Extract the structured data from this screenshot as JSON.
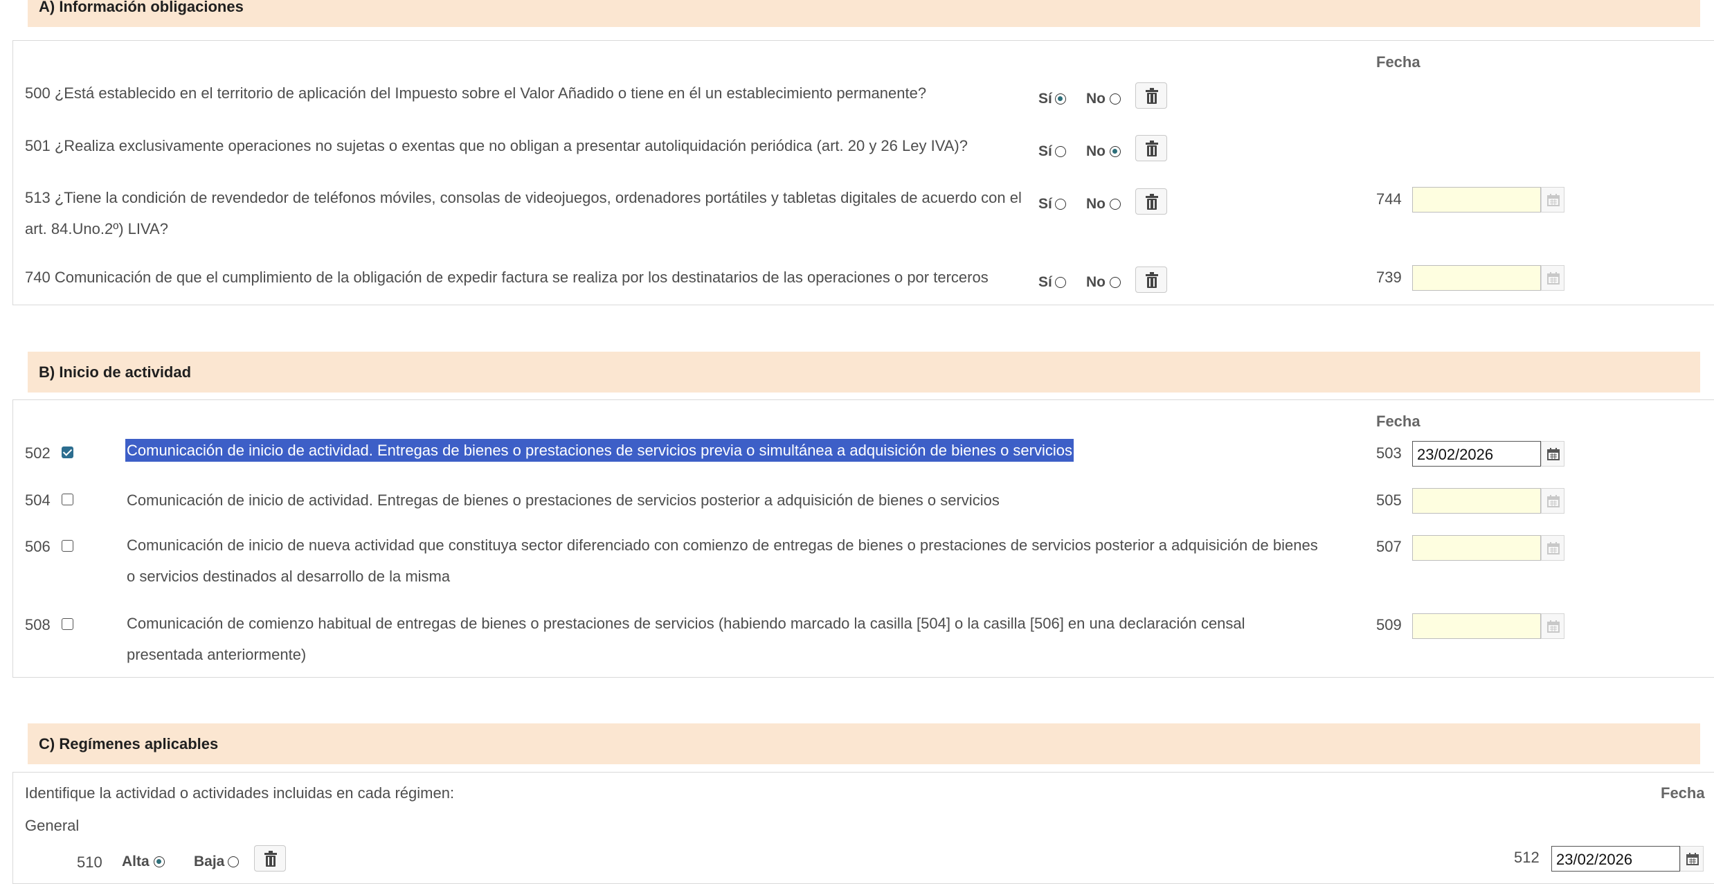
{
  "sectionA": {
    "title": "A) Información obligaciones",
    "fecha_label": "Fecha",
    "yes_label": "Sí",
    "no_label": "No",
    "rows": [
      {
        "code": "500",
        "text": "500 ¿Está establecido en el territorio de aplicación del Impuesto sobre el Valor Añadido o tiene en él un establecimiento permanente?",
        "selected": "si"
      },
      {
        "code": "501",
        "text": "501 ¿Realiza exclusivamente operaciones no sujetas o exentas que no obligan a presentar autoliquidación periódica (art. 20 y 26 Ley IVA)?",
        "selected": "no"
      },
      {
        "code": "513",
        "text": "513 ¿Tiene la condición de revendedor de teléfonos móviles, consolas de videojuegos, ordenadores portátiles y tabletas digitales de acuerdo con el art. 84.Uno.2º) LIVA?",
        "selected": "none",
        "date_code": "744",
        "date_value": ""
      },
      {
        "code": "740",
        "text": "740 Comunicación de que el cumplimiento de la obligación de expedir factura se realiza por los destinatarios de las operaciones o por terceros",
        "selected": "none",
        "date_code": "739",
        "date_value": ""
      }
    ]
  },
  "sectionB": {
    "title": "B) Inicio de actividad",
    "fecha_label": "Fecha",
    "rows": [
      {
        "code": "502",
        "checked": true,
        "text": "Comunicación de inicio de actividad. Entregas de bienes o prestaciones de servicios previa o simultánea a adquisición de bienes o servicios",
        "date_code": "503",
        "date_value": "23/02/2026"
      },
      {
        "code": "504",
        "checked": false,
        "text": "Comunicación de inicio de actividad. Entregas de bienes o prestaciones de servicios posterior a adquisición de bienes o servicios",
        "date_code": "505",
        "date_value": ""
      },
      {
        "code": "506",
        "checked": false,
        "text": "Comunicación de inicio de nueva actividad que constituya sector diferenciado con comienzo de entregas de bienes o prestaciones de servicios posterior a adquisición de bienes o servicios destinados al desarrollo de la misma",
        "date_code": "507",
        "date_value": ""
      },
      {
        "code": "508",
        "checked": false,
        "text": "Comunicación de comienzo habitual de entregas de bienes o prestaciones de servicios (habiendo marcado la casilla [504] o la casilla [506] en una declaración censal presentada anteriormente)",
        "date_code": "509",
        "date_value": ""
      }
    ]
  },
  "sectionC": {
    "title": "C) Regímenes aplicables",
    "fecha_label": "Fecha",
    "intro": "Identifique la actividad o actividades incluidas en cada régimen:",
    "general_label": "General",
    "row": {
      "code": "510",
      "alta_label": "Alta",
      "baja_label": "Baja",
      "selected": "alta",
      "date_code": "512",
      "date_value": "23/02/2026"
    }
  },
  "icons": {
    "trash": "trash-icon",
    "calendar": "calendar-icon"
  },
  "colors": {
    "band": "#fbe6d1",
    "radio_selected": "#2d6f7a",
    "checkbox_checked": "#2c6d8f",
    "selection_highlight": "#3d5fc7",
    "empty_date_bg": "#fefee0"
  }
}
